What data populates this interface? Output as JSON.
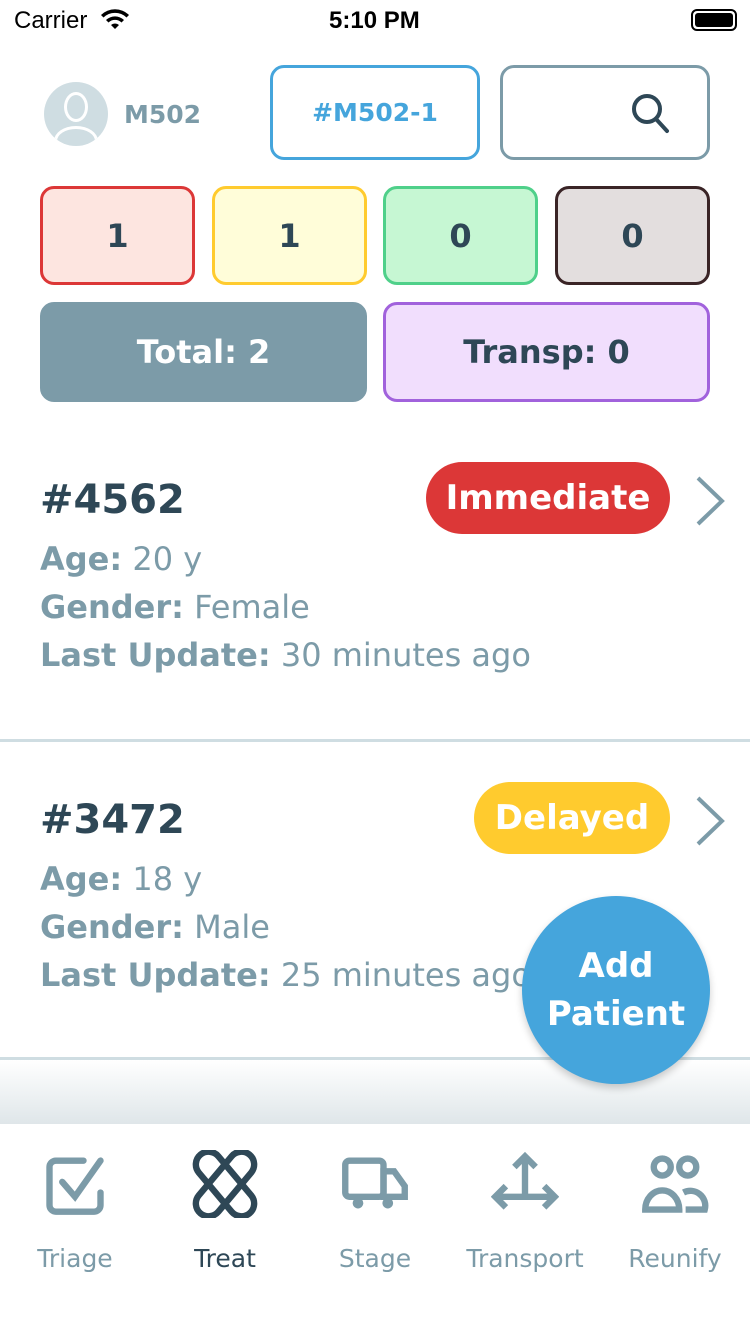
{
  "status_bar": {
    "carrier": "Carrier",
    "time": "5:10 PM"
  },
  "header": {
    "user": "M502",
    "incident": "#M502-1",
    "search_placeholder": ""
  },
  "counts": [
    {
      "value": "1",
      "category": "immediate",
      "bg": "#fde5e0",
      "border": "#dc3737"
    },
    {
      "value": "1",
      "category": "delayed",
      "bg": "#fffdd9",
      "border": "#ffcb2e"
    },
    {
      "value": "0",
      "category": "minor",
      "bg": "#c6f7d3",
      "border": "#4fd08a"
    },
    {
      "value": "0",
      "category": "expectant",
      "bg": "#e3dede",
      "border": "#3a2426"
    }
  ],
  "total": "Total: 2",
  "transport": "Transp: 0",
  "patients": [
    {
      "id": "#4562",
      "status": "Immediate",
      "status_color": "#dc3737",
      "age_label": "Age:",
      "age": " 20 y",
      "gender_label": "Gender:",
      "gender": " Female",
      "update_label": "Last Update:",
      "update": " 30 minutes ago"
    },
    {
      "id": "#3472",
      "status": "Delayed",
      "status_color": "#ffcb2e",
      "age_label": "Age:",
      "age": " 18 y",
      "gender_label": "Gender:",
      "gender": " Male",
      "update_label": "Last Update:",
      "update": " 25 minutes ago"
    }
  ],
  "fab": {
    "line1": "Add",
    "line2": "Patient"
  },
  "tabs": [
    {
      "label": "Triage",
      "icon": "checkbox-icon",
      "active": false
    },
    {
      "label": "Treat",
      "icon": "bandage-icon",
      "active": true
    },
    {
      "label": "Stage",
      "icon": "truck-icon",
      "active": false
    },
    {
      "label": "Transport",
      "icon": "arrows-icon",
      "active": false
    },
    {
      "label": "Reunify",
      "icon": "people-icon",
      "active": false
    }
  ],
  "colors": {
    "primary": "#45a5dc",
    "dark": "#2e4756",
    "muted": "#7c9ba8",
    "transport_bg": "#f1defd",
    "transport_border": "#a162dc"
  }
}
